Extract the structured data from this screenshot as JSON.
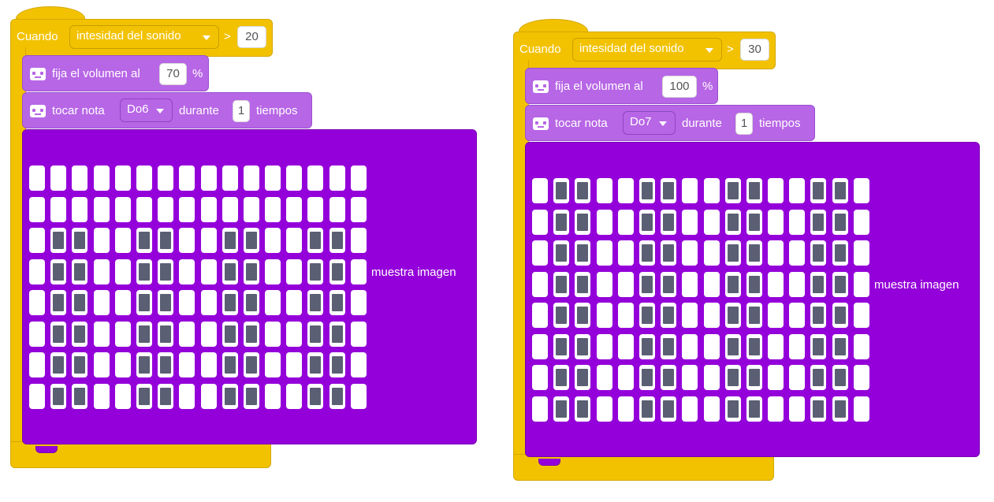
{
  "stacks": [
    {
      "event": {
        "when_label": "Cuando",
        "sensor_dropdown": "intesidad del sonido",
        "operator": ">",
        "threshold": "20"
      },
      "set_volume": {
        "label": "fija el volumen al",
        "value": "70",
        "unit": "%"
      },
      "play_note": {
        "label": "tocar nota",
        "note": "Do6",
        "during_label": "durante",
        "beats": "1",
        "beats_unit": "tiempos"
      },
      "show_image": {
        "label": "muestra imagen",
        "matrix": [
          [
            0,
            0,
            0,
            0,
            0,
            0,
            0,
            0,
            0,
            0,
            0,
            0,
            0,
            0,
            0,
            0
          ],
          [
            0,
            0,
            0,
            0,
            0,
            0,
            0,
            0,
            0,
            0,
            0,
            0,
            0,
            0,
            0,
            0
          ],
          [
            0,
            1,
            1,
            0,
            0,
            1,
            1,
            0,
            0,
            1,
            1,
            0,
            0,
            1,
            1,
            0
          ],
          [
            0,
            1,
            1,
            0,
            0,
            1,
            1,
            0,
            0,
            1,
            1,
            0,
            0,
            1,
            1,
            0
          ],
          [
            0,
            1,
            1,
            0,
            0,
            1,
            1,
            0,
            0,
            1,
            1,
            0,
            0,
            1,
            1,
            0
          ],
          [
            0,
            1,
            1,
            0,
            0,
            1,
            1,
            0,
            0,
            1,
            1,
            0,
            0,
            1,
            1,
            0
          ],
          [
            0,
            1,
            1,
            0,
            0,
            1,
            1,
            0,
            0,
            1,
            1,
            0,
            0,
            1,
            1,
            0
          ],
          [
            0,
            1,
            1,
            0,
            0,
            1,
            1,
            0,
            0,
            1,
            1,
            0,
            0,
            1,
            1,
            0
          ]
        ]
      }
    },
    {
      "event": {
        "when_label": "Cuando",
        "sensor_dropdown": "intesidad del sonido",
        "operator": ">",
        "threshold": "30"
      },
      "set_volume": {
        "label": "fija el volumen al",
        "value": "100",
        "unit": "%"
      },
      "play_note": {
        "label": "tocar nota",
        "note": "Do7",
        "during_label": "durante",
        "beats": "1",
        "beats_unit": "tiempos"
      },
      "show_image": {
        "label": "muestra imagen",
        "matrix": [
          [
            0,
            1,
            1,
            0,
            0,
            1,
            1,
            0,
            0,
            1,
            1,
            0,
            0,
            1,
            1,
            0
          ],
          [
            0,
            1,
            1,
            0,
            0,
            1,
            1,
            0,
            0,
            1,
            1,
            0,
            0,
            1,
            1,
            0
          ],
          [
            0,
            1,
            1,
            0,
            0,
            1,
            1,
            0,
            0,
            1,
            1,
            0,
            0,
            1,
            1,
            0
          ],
          [
            0,
            1,
            1,
            0,
            0,
            1,
            1,
            0,
            0,
            1,
            1,
            0,
            0,
            1,
            1,
            0
          ],
          [
            0,
            1,
            1,
            0,
            0,
            1,
            1,
            0,
            0,
            1,
            1,
            0,
            0,
            1,
            1,
            0
          ],
          [
            0,
            1,
            1,
            0,
            0,
            1,
            1,
            0,
            0,
            1,
            1,
            0,
            0,
            1,
            1,
            0
          ],
          [
            0,
            1,
            1,
            0,
            0,
            1,
            1,
            0,
            0,
            1,
            1,
            0,
            0,
            1,
            1,
            0
          ],
          [
            0,
            1,
            1,
            0,
            0,
            1,
            1,
            0,
            0,
            1,
            1,
            0,
            0,
            1,
            1,
            0
          ]
        ]
      }
    }
  ],
  "colors": {
    "event_block": "#f2c200",
    "sound_block": "#b766e6",
    "display_block": "#9400d9",
    "led_on": "#5b5f73",
    "led_off": "#ffffff"
  },
  "icons": {
    "sound_block_icon": "robot-icon",
    "dropdown_icon": "caret-down-icon"
  }
}
